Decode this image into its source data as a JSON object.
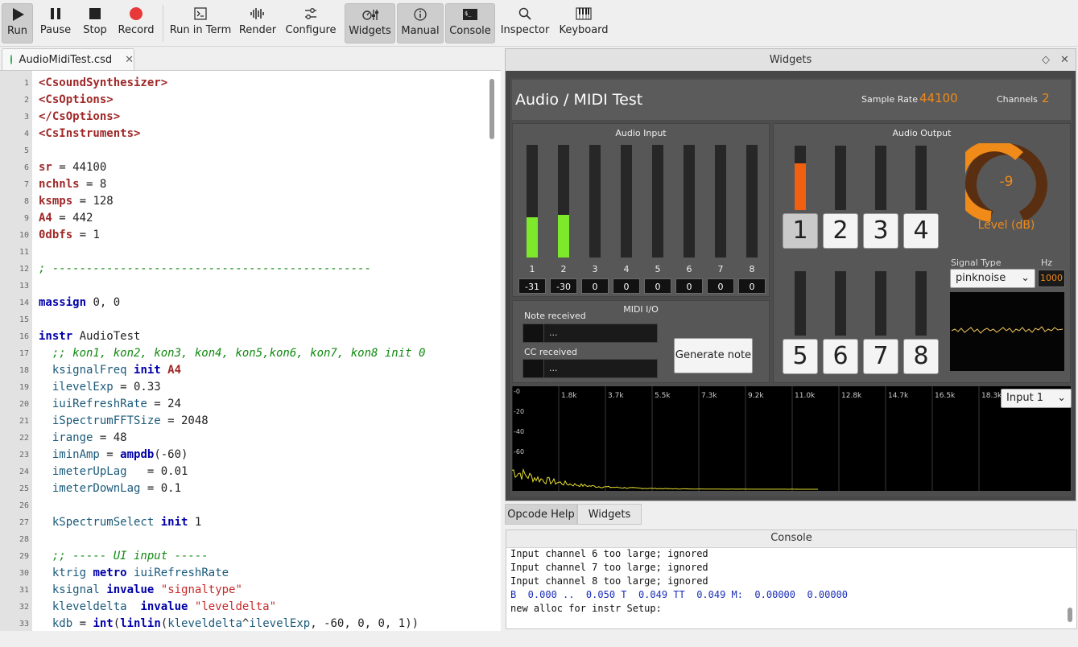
{
  "toolbar": {
    "buttons": [
      {
        "label": "Run",
        "icon": "play-icon"
      },
      {
        "label": "Pause",
        "icon": "pause-icon"
      },
      {
        "label": "Stop",
        "icon": "stop-icon"
      },
      {
        "label": "Record",
        "icon": "record-icon"
      },
      {
        "label": "Run in Term",
        "icon": "terminal-icon"
      },
      {
        "label": "Render",
        "icon": "render-icon"
      },
      {
        "label": "Configure",
        "icon": "sliders-icon"
      },
      {
        "label": "Widgets",
        "icon": "widgets-icon"
      },
      {
        "label": "Manual",
        "icon": "info-icon"
      },
      {
        "label": "Console",
        "icon": "console-icon"
      },
      {
        "label": "Inspector",
        "icon": "search-icon"
      },
      {
        "label": "Keyboard",
        "icon": "piano-keyboard-icon"
      }
    ]
  },
  "editor": {
    "tab_title": "AudioMidiTest.csd",
    "line_numbers": [
      "1",
      "2",
      "3",
      "4",
      "5",
      "6",
      "7",
      "8",
      "9",
      "10",
      "11",
      "12",
      "13",
      "14",
      "15",
      "16",
      "17",
      "18",
      "19",
      "20",
      "21",
      "22",
      "23",
      "24",
      "25",
      "26",
      "27",
      "28",
      "29",
      "30",
      "31",
      "32",
      "33"
    ]
  },
  "widgets": {
    "dock_title": "Widgets",
    "panel_title": "Audio / MIDI Test",
    "sample_rate_label": "Sample Rate",
    "sample_rate_value": "44100",
    "channels_label": "Channels",
    "channels_value": "2",
    "audio_input": {
      "title": "Audio Input",
      "channels": [
        "1",
        "2",
        "3",
        "4",
        "5",
        "6",
        "7",
        "8"
      ],
      "values": [
        "-31",
        "-30",
        "0",
        "0",
        "0",
        "0",
        "0",
        "0"
      ],
      "levels": [
        0.36,
        0.38,
        0,
        0,
        0,
        0,
        0,
        0
      ]
    },
    "audio_output": {
      "title": "Audio Output",
      "buttons_top": [
        "1",
        "2",
        "3",
        "4"
      ],
      "buttons_bottom": [
        "5",
        "6",
        "7",
        "8"
      ],
      "levels_top": [
        0.72,
        0,
        0,
        0
      ],
      "levels_bottom": [
        0,
        0,
        0,
        0
      ],
      "dial_value": "-9",
      "dial_label": "Level (dB)",
      "signal_type_label": "Signal Type",
      "signal_type_value": "pinknoise",
      "hz_label": "Hz",
      "hz_value": "1000"
    },
    "midi": {
      "title": "MIDI I/O",
      "note_label": "Note received",
      "note_value": "...",
      "cc_label": "CC received",
      "cc_value": "...",
      "generate_button": "Generate note"
    },
    "spectrum": {
      "x_ticks": [
        "1.8k",
        "3.7k",
        "5.5k",
        "7.3k",
        "9.2k",
        "11.0k",
        "12.8k",
        "14.7k",
        "16.5k",
        "18.3k"
      ],
      "y_ticks": [
        "-0",
        "-20",
        "-40",
        "-60"
      ],
      "input_select": "Input 1"
    }
  },
  "bottom_tabs": [
    "Opcode Help",
    "Widgets"
  ],
  "console": {
    "title": "Console",
    "lines": [
      "Input channel 6 too large; ignored",
      "Input channel 7 too large; ignored",
      "Input channel 8 too large; ignored",
      "B  0.000 ..  0.050 T  0.049 TT  0.049 M:  0.00000  0.00000",
      "new alloc for instr Setup:"
    ]
  },
  "colors": {
    "meter_green": "#7ee82a",
    "meter_orange": "#f06010",
    "accent_orange": "#f08a18",
    "dial_dark": "#5a2e10",
    "console_blue": "#1a2eb8"
  }
}
